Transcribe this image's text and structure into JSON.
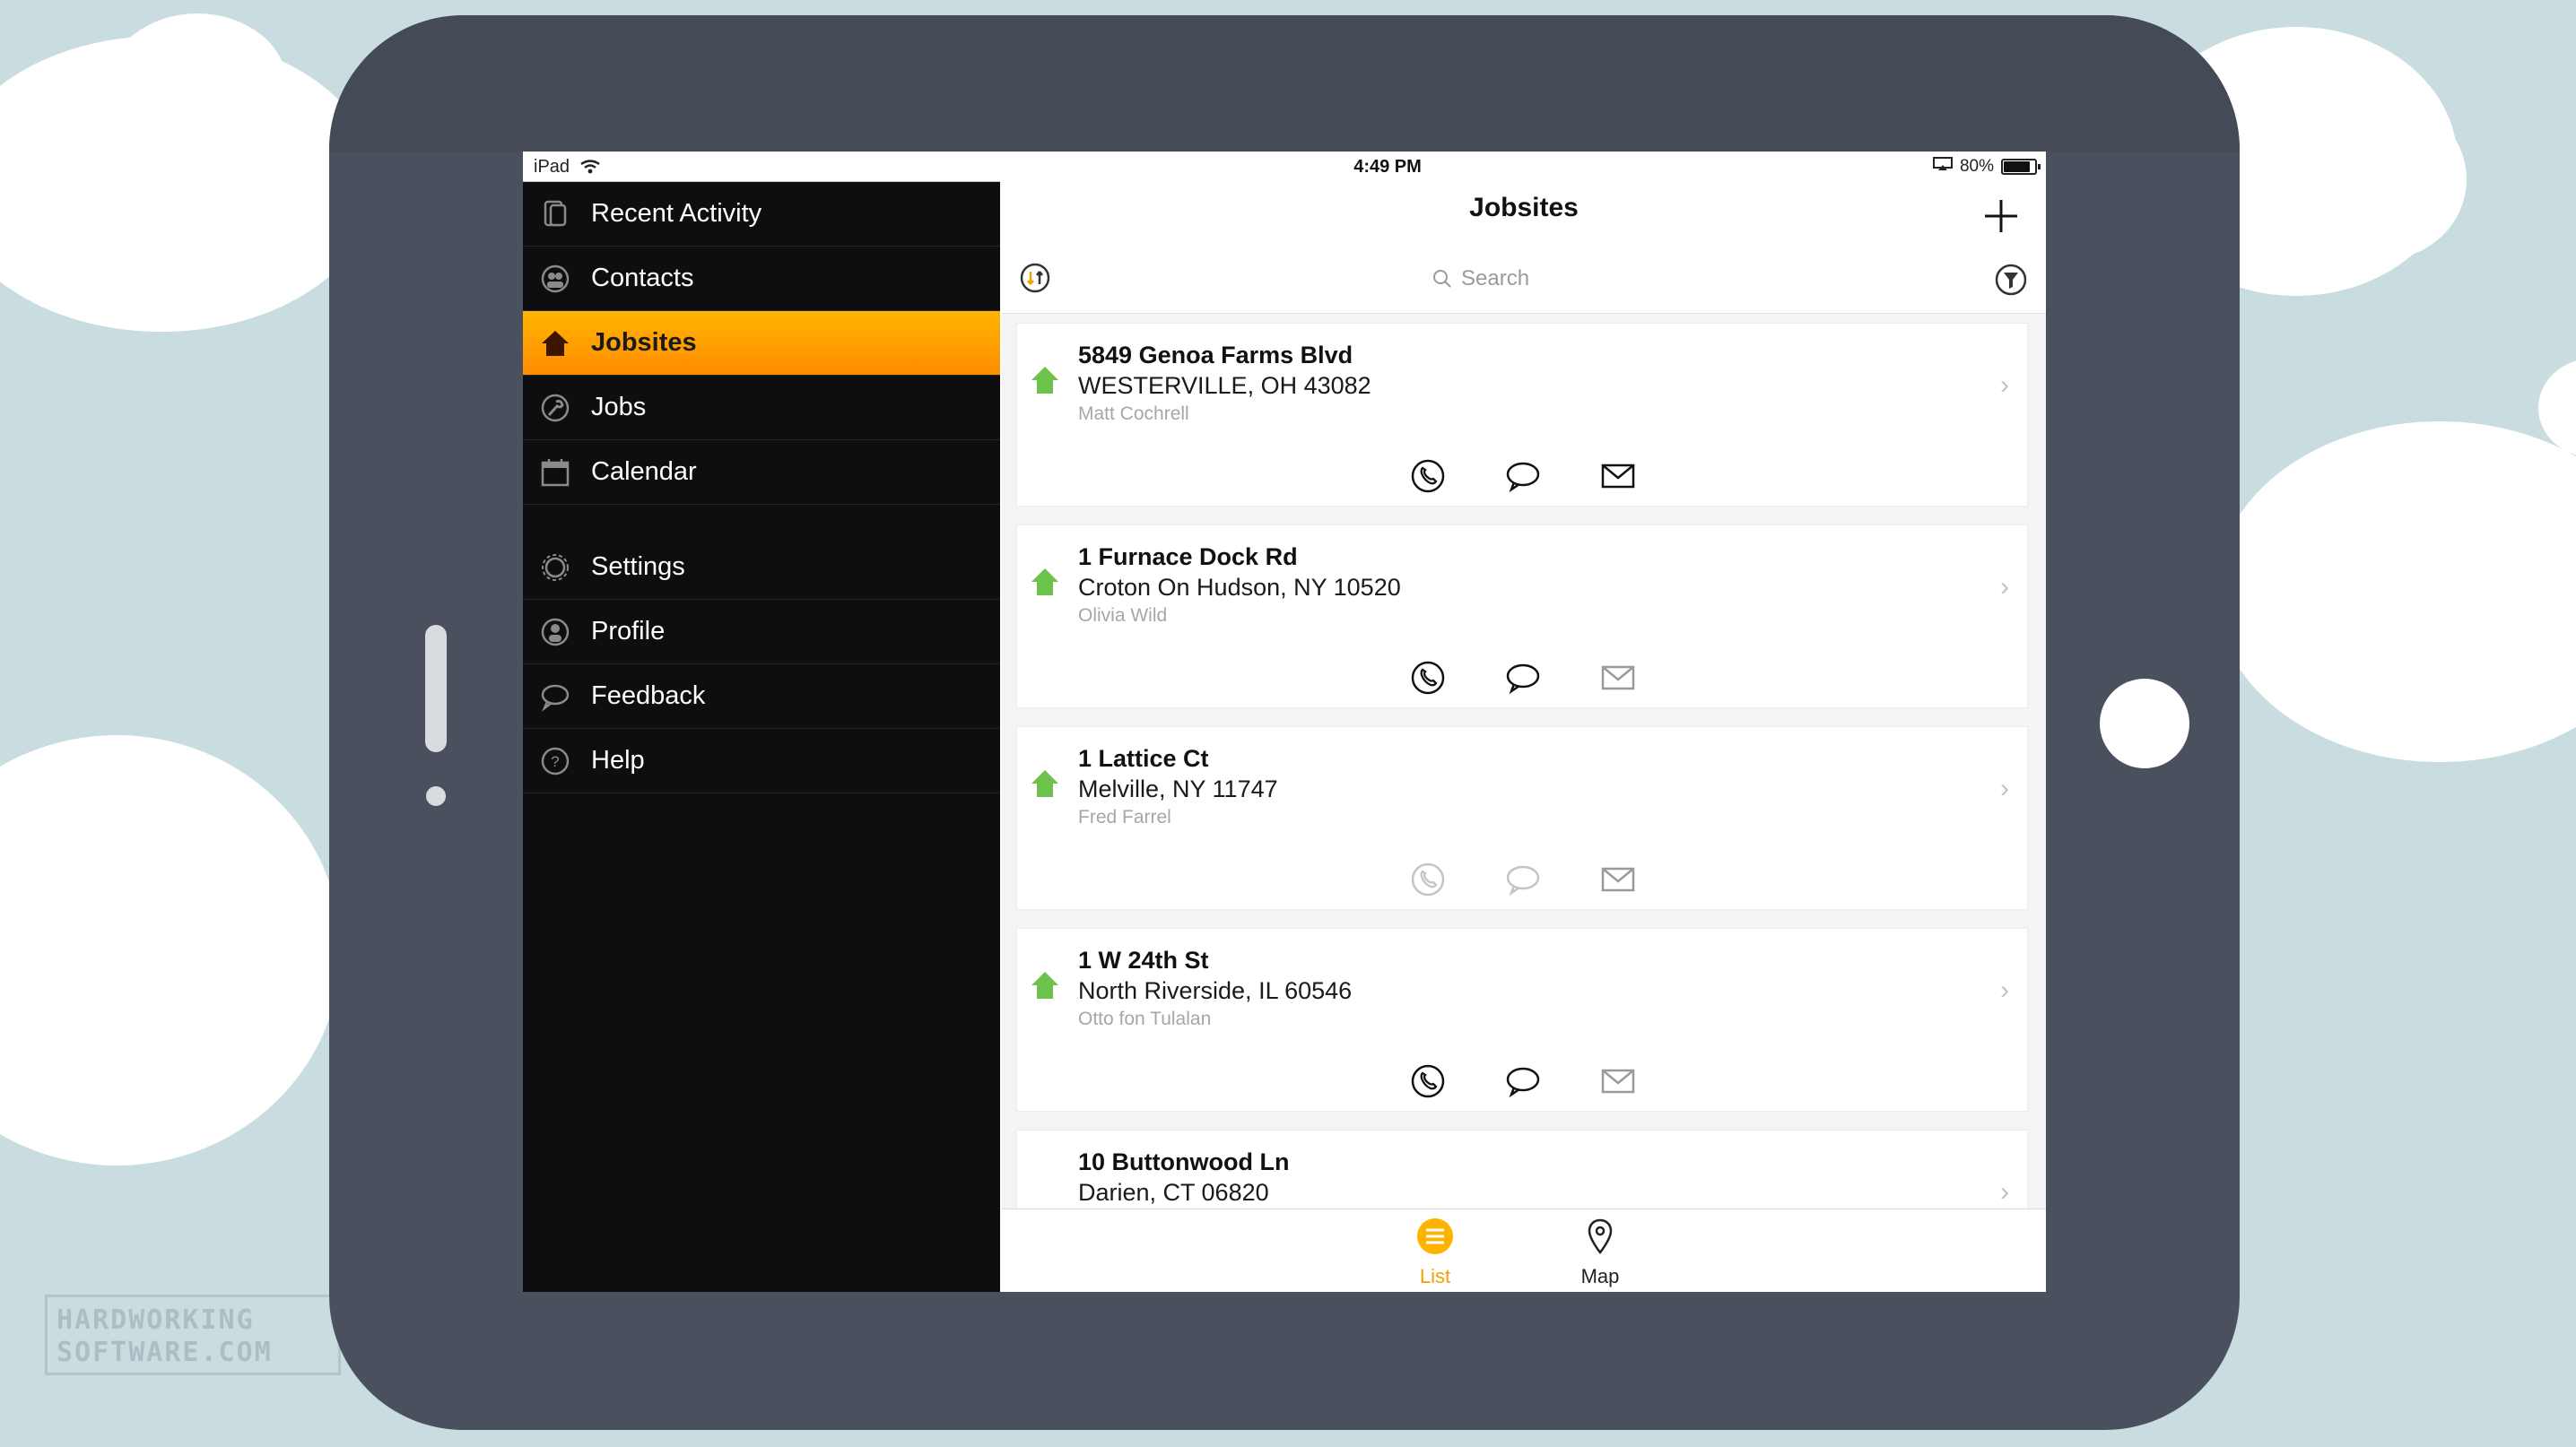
{
  "status_bar": {
    "device": "iPad",
    "time": "4:49 PM",
    "battery": "80%",
    "battery_fraction": 0.8
  },
  "sidebar": {
    "items": [
      {
        "label": "Recent Activity",
        "icon": "recent-activity-icon"
      },
      {
        "label": "Contacts",
        "icon": "contacts-icon"
      },
      {
        "label": "Jobsites",
        "icon": "house-icon",
        "active": true
      },
      {
        "label": "Jobs",
        "icon": "wrench-icon"
      },
      {
        "label": "Calendar",
        "icon": "calendar-icon"
      },
      {
        "label": "Settings",
        "icon": "gear-icon"
      },
      {
        "label": "Profile",
        "icon": "profile-icon"
      },
      {
        "label": "Feedback",
        "icon": "speech-bubble-icon"
      },
      {
        "label": "Help",
        "icon": "help-icon"
      }
    ]
  },
  "header": {
    "title": "Jobsites",
    "search_placeholder": "Search"
  },
  "jobsites": [
    {
      "address1": "5849 Genoa Farms Blvd",
      "address2": "WESTERVILLE, OH 43082",
      "contact": "Matt Cochrell",
      "phone_enabled": true,
      "message_enabled": true,
      "email_enabled": true
    },
    {
      "address1": "1 Furnace Dock Rd",
      "address2": "Croton On Hudson, NY 10520",
      "contact": "Olivia Wild",
      "phone_enabled": true,
      "message_enabled": true,
      "email_enabled": false
    },
    {
      "address1": "1 Lattice Ct",
      "address2": "Melville, NY 11747",
      "contact": "Fred Farrel",
      "phone_enabled": false,
      "message_enabled": false,
      "email_enabled": false
    },
    {
      "address1": "1 W 24th St",
      "address2": "North Riverside, IL 60546",
      "contact": "Otto fon Tulalan",
      "phone_enabled": true,
      "message_enabled": true,
      "email_enabled": false
    },
    {
      "address1": "10 Buttonwood Ln",
      "address2": "Darien, CT 06820",
      "contact": "",
      "phone_enabled": false,
      "message_enabled": false,
      "email_enabled": false
    }
  ],
  "tab_bar": {
    "list_label": "List",
    "map_label": "Map"
  },
  "watermark": {
    "line1": "HARDWORKING",
    "line2": "SOFTWARE.COM"
  },
  "colors": {
    "accent": "#ff9d00",
    "house_green": "#6cc24a",
    "sidebar_bg": "#0e0e10",
    "tablet_bezel": "#4b505e",
    "background": "#c9dde1"
  }
}
